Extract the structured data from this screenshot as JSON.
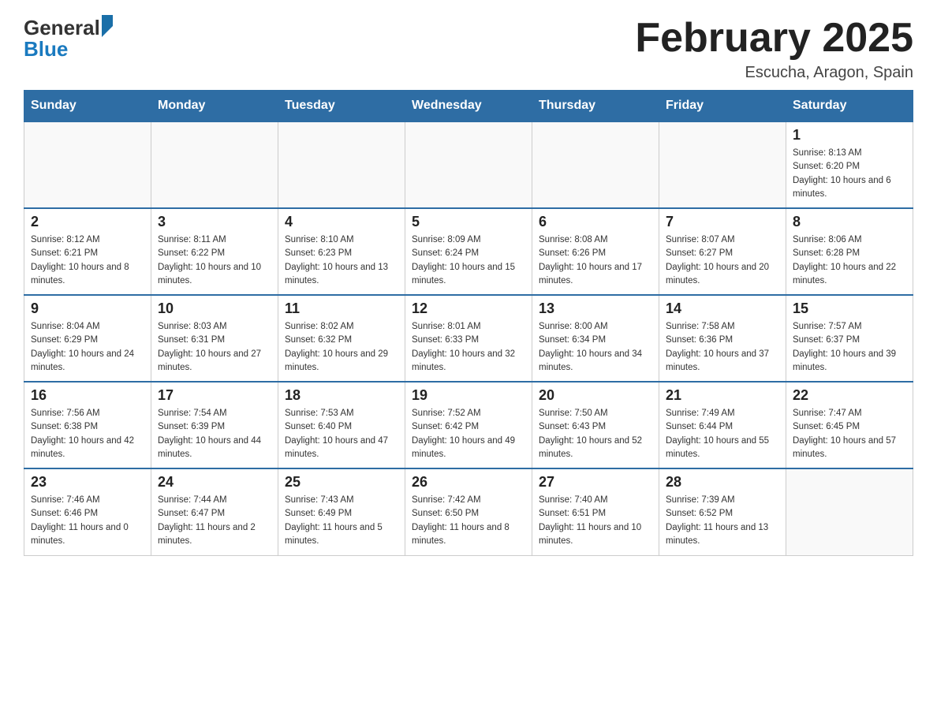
{
  "header": {
    "logo": {
      "general": "General",
      "blue": "Blue"
    },
    "title": "February 2025",
    "subtitle": "Escucha, Aragon, Spain"
  },
  "weekdays": [
    "Sunday",
    "Monday",
    "Tuesday",
    "Wednesday",
    "Thursday",
    "Friday",
    "Saturday"
  ],
  "weeks": [
    [
      {
        "day": "",
        "info": ""
      },
      {
        "day": "",
        "info": ""
      },
      {
        "day": "",
        "info": ""
      },
      {
        "day": "",
        "info": ""
      },
      {
        "day": "",
        "info": ""
      },
      {
        "day": "",
        "info": ""
      },
      {
        "day": "1",
        "info": "Sunrise: 8:13 AM\nSunset: 6:20 PM\nDaylight: 10 hours and 6 minutes."
      }
    ],
    [
      {
        "day": "2",
        "info": "Sunrise: 8:12 AM\nSunset: 6:21 PM\nDaylight: 10 hours and 8 minutes."
      },
      {
        "day": "3",
        "info": "Sunrise: 8:11 AM\nSunset: 6:22 PM\nDaylight: 10 hours and 10 minutes."
      },
      {
        "day": "4",
        "info": "Sunrise: 8:10 AM\nSunset: 6:23 PM\nDaylight: 10 hours and 13 minutes."
      },
      {
        "day": "5",
        "info": "Sunrise: 8:09 AM\nSunset: 6:24 PM\nDaylight: 10 hours and 15 minutes."
      },
      {
        "day": "6",
        "info": "Sunrise: 8:08 AM\nSunset: 6:26 PM\nDaylight: 10 hours and 17 minutes."
      },
      {
        "day": "7",
        "info": "Sunrise: 8:07 AM\nSunset: 6:27 PM\nDaylight: 10 hours and 20 minutes."
      },
      {
        "day": "8",
        "info": "Sunrise: 8:06 AM\nSunset: 6:28 PM\nDaylight: 10 hours and 22 minutes."
      }
    ],
    [
      {
        "day": "9",
        "info": "Sunrise: 8:04 AM\nSunset: 6:29 PM\nDaylight: 10 hours and 24 minutes."
      },
      {
        "day": "10",
        "info": "Sunrise: 8:03 AM\nSunset: 6:31 PM\nDaylight: 10 hours and 27 minutes."
      },
      {
        "day": "11",
        "info": "Sunrise: 8:02 AM\nSunset: 6:32 PM\nDaylight: 10 hours and 29 minutes."
      },
      {
        "day": "12",
        "info": "Sunrise: 8:01 AM\nSunset: 6:33 PM\nDaylight: 10 hours and 32 minutes."
      },
      {
        "day": "13",
        "info": "Sunrise: 8:00 AM\nSunset: 6:34 PM\nDaylight: 10 hours and 34 minutes."
      },
      {
        "day": "14",
        "info": "Sunrise: 7:58 AM\nSunset: 6:36 PM\nDaylight: 10 hours and 37 minutes."
      },
      {
        "day": "15",
        "info": "Sunrise: 7:57 AM\nSunset: 6:37 PM\nDaylight: 10 hours and 39 minutes."
      }
    ],
    [
      {
        "day": "16",
        "info": "Sunrise: 7:56 AM\nSunset: 6:38 PM\nDaylight: 10 hours and 42 minutes."
      },
      {
        "day": "17",
        "info": "Sunrise: 7:54 AM\nSunset: 6:39 PM\nDaylight: 10 hours and 44 minutes."
      },
      {
        "day": "18",
        "info": "Sunrise: 7:53 AM\nSunset: 6:40 PM\nDaylight: 10 hours and 47 minutes."
      },
      {
        "day": "19",
        "info": "Sunrise: 7:52 AM\nSunset: 6:42 PM\nDaylight: 10 hours and 49 minutes."
      },
      {
        "day": "20",
        "info": "Sunrise: 7:50 AM\nSunset: 6:43 PM\nDaylight: 10 hours and 52 minutes."
      },
      {
        "day": "21",
        "info": "Sunrise: 7:49 AM\nSunset: 6:44 PM\nDaylight: 10 hours and 55 minutes."
      },
      {
        "day": "22",
        "info": "Sunrise: 7:47 AM\nSunset: 6:45 PM\nDaylight: 10 hours and 57 minutes."
      }
    ],
    [
      {
        "day": "23",
        "info": "Sunrise: 7:46 AM\nSunset: 6:46 PM\nDaylight: 11 hours and 0 minutes."
      },
      {
        "day": "24",
        "info": "Sunrise: 7:44 AM\nSunset: 6:47 PM\nDaylight: 11 hours and 2 minutes."
      },
      {
        "day": "25",
        "info": "Sunrise: 7:43 AM\nSunset: 6:49 PM\nDaylight: 11 hours and 5 minutes."
      },
      {
        "day": "26",
        "info": "Sunrise: 7:42 AM\nSunset: 6:50 PM\nDaylight: 11 hours and 8 minutes."
      },
      {
        "day": "27",
        "info": "Sunrise: 7:40 AM\nSunset: 6:51 PM\nDaylight: 11 hours and 10 minutes."
      },
      {
        "day": "28",
        "info": "Sunrise: 7:39 AM\nSunset: 6:52 PM\nDaylight: 11 hours and 13 minutes."
      },
      {
        "day": "",
        "info": ""
      }
    ]
  ]
}
